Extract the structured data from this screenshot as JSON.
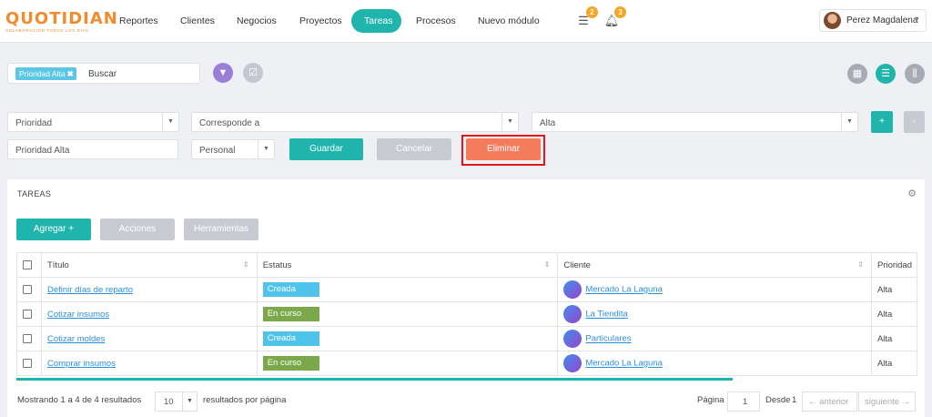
{
  "brand": {
    "name": "QUOTIDIAN",
    "tagline": "COLABORACIÓN TODOS LOS DÍAS"
  },
  "nav": [
    "Reportes",
    "Clientes",
    "Negocios",
    "Proyectos",
    "Tareas",
    "Procesos",
    "Nuevo módulo"
  ],
  "nav_active": "Tareas",
  "notifications": {
    "messages_count": "2",
    "alerts_count": "3"
  },
  "user": {
    "name": "Perez Magdalena"
  },
  "search": {
    "chip": "Prioridad Alta",
    "chip_close": "✖",
    "text": "Buscar"
  },
  "filters": {
    "field1": "Prioridad",
    "operator": "Corresponde a",
    "value": "Alta",
    "add": "+",
    "remove": "-",
    "filter_name": "Prioridad Alta",
    "scope": "Personal",
    "save": "Guardar",
    "cancel": "Cancelar",
    "delete": "Eliminar"
  },
  "panel": {
    "title": "TAREAS",
    "add_button": "Agregar +",
    "actions_button": "Acciones",
    "tools_button": "Herramientas",
    "columns": [
      "Título",
      "Estatus",
      "Cliente",
      "Prioridad"
    ],
    "rows": [
      {
        "title": "Definir días de reparto",
        "status": "Creada",
        "status_color": "#4fc3ea",
        "client": "Mercado La Laguna",
        "priority": "Alta"
      },
      {
        "title": "Cotizar insumos",
        "status": "En curso",
        "status_color": "#7ba84a",
        "client": "La Tiendita",
        "priority": "Alta"
      },
      {
        "title": "Cotizar moldes",
        "status": "Creada",
        "status_color": "#4fc3ea",
        "client": "Particulares",
        "priority": "Alta"
      },
      {
        "title": "Comprar insumos",
        "status": "En curso",
        "status_color": "#7ba84a",
        "client": "Mercado La Laguna",
        "priority": "Alta"
      }
    ]
  },
  "footer": {
    "showing": "Mostrando 1 a 4 de 4 resultados",
    "page_size": "10",
    "per_page": "resultados por página",
    "page_label": "Página",
    "page_value": "1",
    "from_label": "Desde",
    "from_value": "1",
    "prev": "← anterior",
    "next": "siguiente →"
  },
  "colors": {
    "accent": "#1fb5ac",
    "danger": "#f47b5c",
    "link": "#2b8fd8",
    "filter_purple": "#9b7fd6"
  }
}
